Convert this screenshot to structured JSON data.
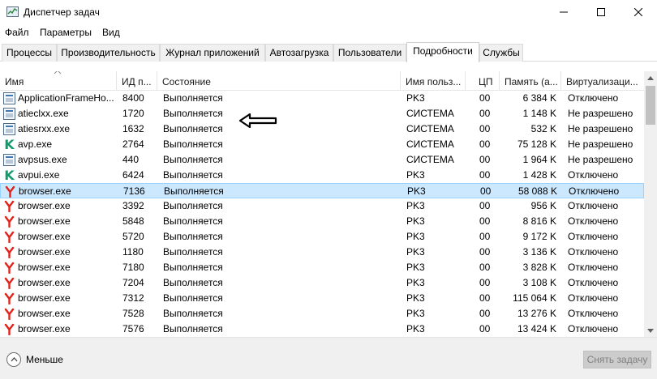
{
  "window": {
    "title": "Диспетчер задач",
    "controls": {
      "minimize": "minimize-icon",
      "maximize": "maximize-icon",
      "close": "close-icon"
    }
  },
  "menu": [
    "Файл",
    "Параметры",
    "Вид"
  ],
  "tabs": [
    {
      "label": "Процессы",
      "active": false
    },
    {
      "label": "Производительность",
      "active": false
    },
    {
      "label": "Журнал приложений",
      "active": false
    },
    {
      "label": "Автозагрузка",
      "active": false
    },
    {
      "label": "Пользователи",
      "active": false
    },
    {
      "label": "Подробности",
      "active": true
    },
    {
      "label": "Службы",
      "active": false
    }
  ],
  "table": {
    "columns": [
      "Имя",
      "ИД п...",
      "Состояние",
      "Имя польз...",
      "ЦП",
      "Память (а...",
      "Виртуализаци..."
    ],
    "sorted_by": "Имя",
    "rows": [
      {
        "icon": "app-window-icon",
        "name": "ApplicationFrameHo...",
        "pid": "8400",
        "status": "Выполняется",
        "user": "PK3",
        "cpu": "00",
        "memory": "6 384 K",
        "virtualization": "Отключено",
        "selected": false
      },
      {
        "icon": "app-window-icon",
        "name": "atieclxx.exe",
        "pid": "1720",
        "status": "Выполняется",
        "user": "СИСТЕМА",
        "cpu": "00",
        "memory": "1 148 K",
        "virtualization": "Не разрешено",
        "selected": false
      },
      {
        "icon": "app-window-icon",
        "name": "atiesrxx.exe",
        "pid": "1632",
        "status": "Выполняется",
        "user": "СИСТЕМА",
        "cpu": "00",
        "memory": "532 K",
        "virtualization": "Не разрешено",
        "selected": false
      },
      {
        "icon": "kaspersky-icon",
        "name": "avp.exe",
        "pid": "2764",
        "status": "Выполняется",
        "user": "СИСТЕМА",
        "cpu": "00",
        "memory": "75 128 K",
        "virtualization": "Не разрешено",
        "selected": false
      },
      {
        "icon": "app-window-icon",
        "name": "avpsus.exe",
        "pid": "440",
        "status": "Выполняется",
        "user": "СИСТЕМА",
        "cpu": "00",
        "memory": "1 964 K",
        "virtualization": "Не разрешено",
        "selected": false
      },
      {
        "icon": "kaspersky-icon",
        "name": "avpui.exe",
        "pid": "6424",
        "status": "Выполняется",
        "user": "PK3",
        "cpu": "00",
        "memory": "1 428 K",
        "virtualization": "Отключено",
        "selected": false
      },
      {
        "icon": "yandex-browser-icon",
        "name": "browser.exe",
        "pid": "7136",
        "status": "Выполняется",
        "user": "PK3",
        "cpu": "00",
        "memory": "58 088 K",
        "virtualization": "Отключено",
        "selected": true
      },
      {
        "icon": "yandex-browser-icon",
        "name": "browser.exe",
        "pid": "3392",
        "status": "Выполняется",
        "user": "PK3",
        "cpu": "00",
        "memory": "956 K",
        "virtualization": "Отключено",
        "selected": false
      },
      {
        "icon": "yandex-browser-icon",
        "name": "browser.exe",
        "pid": "5848",
        "status": "Выполняется",
        "user": "PK3",
        "cpu": "00",
        "memory": "8 816 K",
        "virtualization": "Отключено",
        "selected": false
      },
      {
        "icon": "yandex-browser-icon",
        "name": "browser.exe",
        "pid": "5720",
        "status": "Выполняется",
        "user": "PK3",
        "cpu": "00",
        "memory": "9 172 K",
        "virtualization": "Отключено",
        "selected": false
      },
      {
        "icon": "yandex-browser-icon",
        "name": "browser.exe",
        "pid": "1180",
        "status": "Выполняется",
        "user": "PK3",
        "cpu": "00",
        "memory": "3 136 K",
        "virtualization": "Отключено",
        "selected": false
      },
      {
        "icon": "yandex-browser-icon",
        "name": "browser.exe",
        "pid": "7180",
        "status": "Выполняется",
        "user": "PK3",
        "cpu": "00",
        "memory": "3 828 K",
        "virtualization": "Отключено",
        "selected": false
      },
      {
        "icon": "yandex-browser-icon",
        "name": "browser.exe",
        "pid": "7204",
        "status": "Выполняется",
        "user": "PK3",
        "cpu": "00",
        "memory": "3 108 K",
        "virtualization": "Отключено",
        "selected": false
      },
      {
        "icon": "yandex-browser-icon",
        "name": "browser.exe",
        "pid": "7312",
        "status": "Выполняется",
        "user": "PK3",
        "cpu": "00",
        "memory": "115 064 K",
        "virtualization": "Отключено",
        "selected": false
      },
      {
        "icon": "yandex-browser-icon",
        "name": "browser.exe",
        "pid": "7528",
        "status": "Выполняется",
        "user": "PK3",
        "cpu": "00",
        "memory": "13 276 K",
        "virtualization": "Отключено",
        "selected": false
      },
      {
        "icon": "yandex-browser-icon",
        "name": "browser.exe",
        "pid": "7576",
        "status": "Выполняется",
        "user": "PK3",
        "cpu": "00",
        "memory": "13 424 K",
        "virtualization": "Отключено",
        "selected": false
      }
    ]
  },
  "annotation": {
    "icon": "left-arrow-icon"
  },
  "footer": {
    "fewer_label": "Меньше",
    "end_task_label": "Снять задачу"
  },
  "colors": {
    "selection": "#cce8ff",
    "selection_border": "#99d1ff",
    "yandex_red": "#e0241b",
    "kaspersky_green": "#139a6c"
  }
}
